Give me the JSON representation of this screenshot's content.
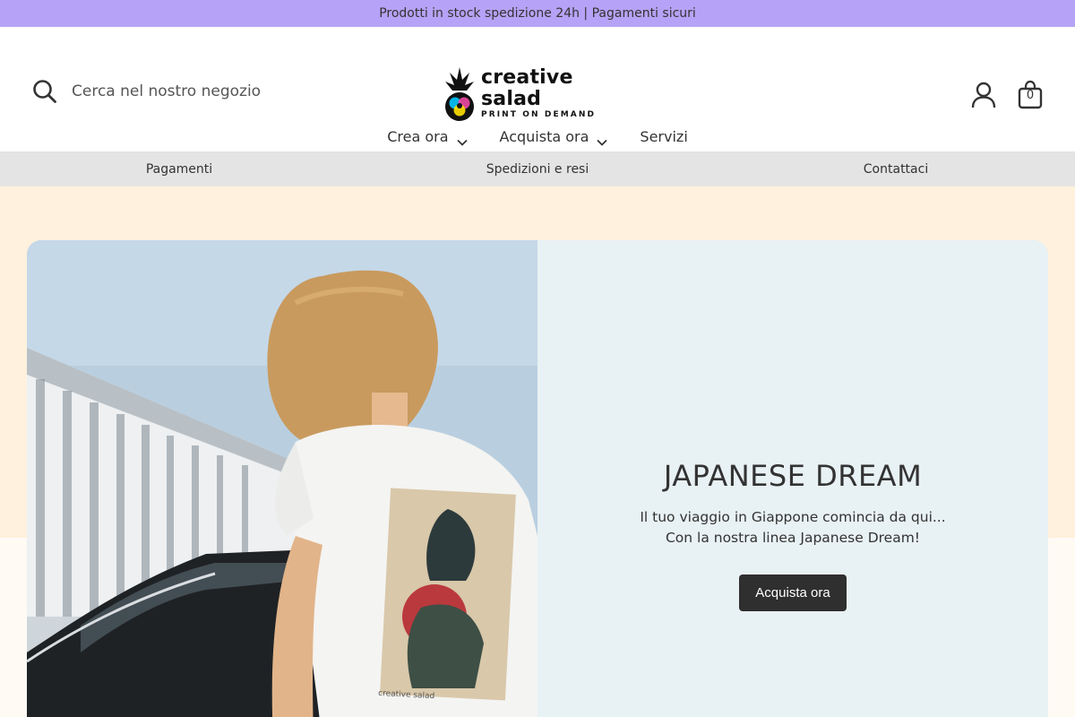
{
  "announcement": {
    "text": "Prodotti in stock spedizione 24h | Pagamenti sicuri"
  },
  "header": {
    "search": {
      "placeholder": "Cerca nel nostro negozio",
      "icon": "search-icon"
    },
    "logo": {
      "name": "creative salad",
      "tagline": "PRINT ON DEMAND"
    },
    "account_icon": "account-icon",
    "cart": {
      "icon": "bag-icon",
      "count": "0"
    }
  },
  "nav": {
    "items": [
      {
        "label": "Crea ora",
        "has_dropdown": true
      },
      {
        "label": "Acquista ora",
        "has_dropdown": true
      },
      {
        "label": "Servizi",
        "has_dropdown": false
      }
    ]
  },
  "subnav": {
    "items": [
      {
        "label": "Pagamenti"
      },
      {
        "label": "Spedizioni e resi"
      },
      {
        "label": "Contattaci"
      }
    ]
  },
  "hero": {
    "title": "JAPANESE DREAM",
    "text_line1": "Il tuo viaggio in Giappone comincia da qui...",
    "text_line2": "Con la nostra linea Japanese Dream!",
    "cta": "Acquista ora",
    "shirt_print_text": "creative salad"
  },
  "colors": {
    "announcement_bg": "#b6a2f6",
    "subnav_bg": "#e4e4e4",
    "hero_section_bg": "#fff1dd",
    "hero_panel_bg": "#e8f1f4",
    "button_bg": "#2f2f2f"
  }
}
